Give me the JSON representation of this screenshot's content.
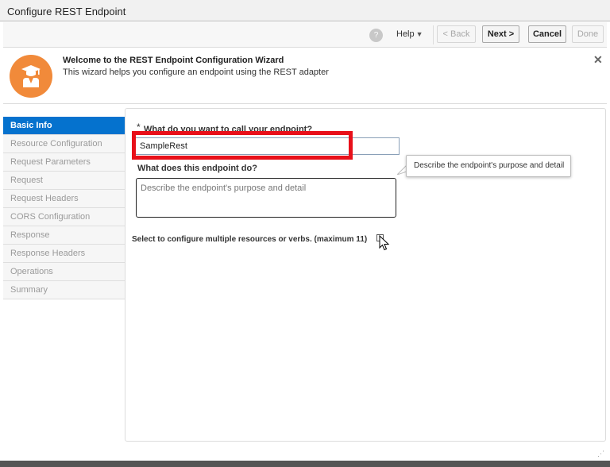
{
  "window": {
    "title": "Configure REST Endpoint"
  },
  "toolbar": {
    "help_label": "Help",
    "back_label": "< Back",
    "next_label": "Next >",
    "cancel_label": "Cancel",
    "done_label": "Done"
  },
  "banner": {
    "title": "Welcome to the REST Endpoint Configuration Wizard",
    "subtitle": "This wizard helps you configure an endpoint using the REST adapter",
    "close_symbol": "✕"
  },
  "sidebar": {
    "items": [
      {
        "label": "Basic Info"
      },
      {
        "label": "Resource Configuration"
      },
      {
        "label": "Request Parameters"
      },
      {
        "label": "Request"
      },
      {
        "label": "Request Headers"
      },
      {
        "label": "CORS Configuration"
      },
      {
        "label": "Response"
      },
      {
        "label": "Response Headers"
      },
      {
        "label": "Operations"
      },
      {
        "label": "Summary"
      }
    ]
  },
  "form": {
    "required_mark": "*",
    "name_label": "What do you want to call your endpoint?",
    "name_value": "SampleRest",
    "desc_label": "What does this endpoint do?",
    "desc_placeholder": "Describe the endpoint's purpose and detail",
    "tooltip": "Describe the endpoint's purpose and detail",
    "multi_label": "Select to configure multiple resources or verbs. (maximum 11)"
  },
  "colors": {
    "accent": "#0572ce",
    "highlight": "#e8101a",
    "logo": "#f18a3a"
  }
}
